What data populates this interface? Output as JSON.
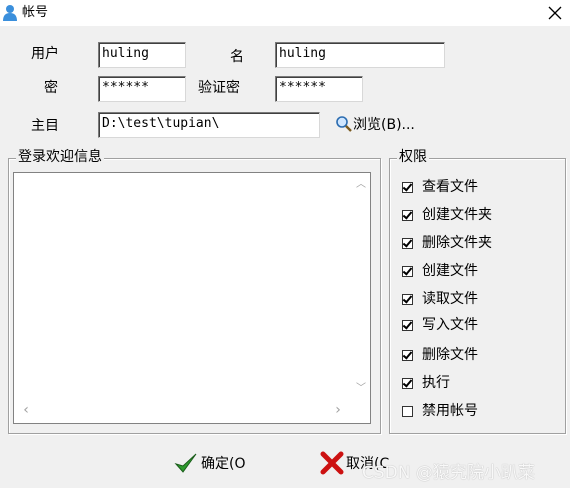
{
  "window": {
    "title": "帐号"
  },
  "form": {
    "user_label": "用户",
    "user_value": "huling",
    "name_label": "名",
    "name_value": "huling",
    "password_label": "密",
    "password_value": "******",
    "verify_label": "验证密",
    "verify_value": "******",
    "home_label": "主目",
    "home_value": "D:\\test\\tupian\\",
    "browse_label": "浏览(B)..."
  },
  "welcome": {
    "legend": "登录欢迎信息",
    "text": ""
  },
  "permissions": {
    "legend": "权限",
    "items": [
      {
        "label": "查看文件",
        "checked": true
      },
      {
        "label": "创建文件夹",
        "checked": true
      },
      {
        "label": "删除文件夹",
        "checked": true
      },
      {
        "label": "创建文件",
        "checked": true
      },
      {
        "label": "读取文件",
        "checked": true
      },
      {
        "label": "写入文件",
        "checked": true
      },
      {
        "label": "删除文件",
        "checked": true
      },
      {
        "label": "执行",
        "checked": true
      },
      {
        "label": "禁用帐号",
        "checked": false
      }
    ]
  },
  "buttons": {
    "ok_label": "确定(O",
    "cancel_label": "取消(C"
  },
  "watermark": "CSDN @猿究院小趴菜",
  "colors": {
    "ok_check": "#2e9a2e",
    "cancel_x": "#cc1111"
  }
}
